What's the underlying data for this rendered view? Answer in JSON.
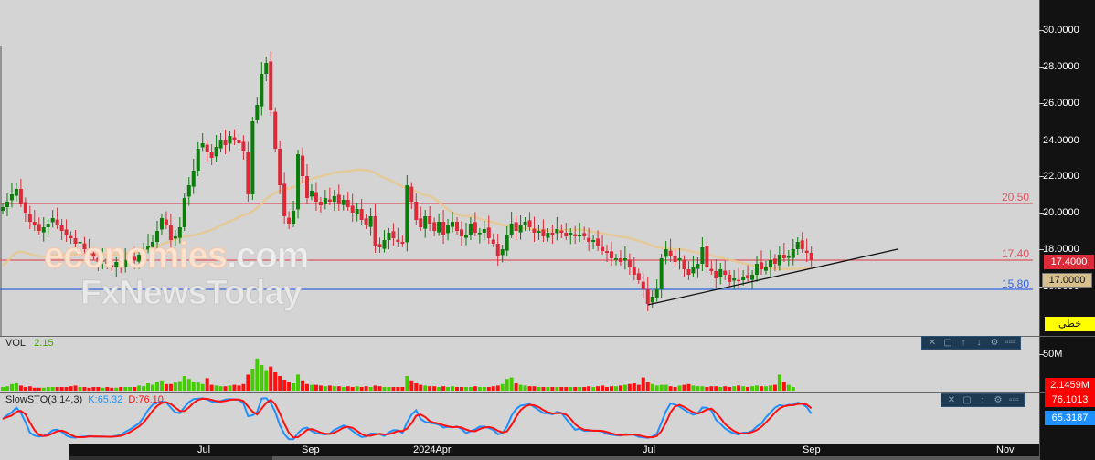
{
  "colors": {
    "up": "#0a7d0a",
    "down": "#dc2a38",
    "vol_up": "#44cc00",
    "vol_down": "#ff1010",
    "ma": "#e8c88e",
    "level_red": "#e05560",
    "level_blue": "#3366dd",
    "stoch_k": "#1e90ff",
    "stoch_d": "#ff1010",
    "trendline": "#111111"
  },
  "watermark": {
    "line1a": "economies",
    "line1b": ".com",
    "line2": "FxNewsToday"
  },
  "price_axis": {
    "ticks": [
      "30.0000",
      "28.0000",
      "26.0000",
      "24.0000",
      "22.0000",
      "20.0000",
      "18.0000",
      "16.0000"
    ],
    "current_price": "17.4000",
    "ma_value": "17.0000",
    "chart_type_label": "خطي"
  },
  "levels": [
    {
      "label": "20.50",
      "value": 20.5,
      "color": "red"
    },
    {
      "label": "17.40",
      "value": 17.4,
      "color": "red"
    },
    {
      "label": "15.80",
      "value": 15.8,
      "color": "blue"
    }
  ],
  "trendline": {
    "from": {
      "index": 142,
      "price": 14.95
    },
    "to": {
      "index": 197,
      "price": 18.0
    }
  },
  "volume_panel": {
    "title": "VOL",
    "value": "2.15",
    "axis_label": "50M",
    "current_label": "2.1459M"
  },
  "stoch_panel": {
    "title": "SlowSTO(3,14,3)",
    "k_label": "K:65.32",
    "d_label": "D:76.10",
    "d_axis": "76.1013",
    "k_axis": "65.3187"
  },
  "time_axis": [
    {
      "label": "Jul",
      "index": 44
    },
    {
      "label": "Sep",
      "index": 67
    },
    {
      "label": "2024Apr",
      "index": 94
    },
    {
      "label": "Jul",
      "index": 142
    },
    {
      "label": "Sep",
      "index": 177
    },
    {
      "label": "Nov",
      "index": 220
    }
  ],
  "panel_toolbar": {
    "icons": [
      "close-icon",
      "maximize-icon",
      "move-up-icon",
      "move-down-icon",
      "settings-icon",
      "more-icon"
    ]
  },
  "chart_data": {
    "type": "candlestick",
    "price_range": [
      14,
      31
    ],
    "close": [
      20.3,
      20.6,
      21.0,
      21.3,
      20.5,
      20.0,
      19.5,
      19.3,
      19.0,
      19.2,
      19.4,
      19.7,
      19.3,
      19.0,
      18.8,
      18.6,
      18.3,
      18.4,
      18.0,
      17.7,
      17.6,
      17.3,
      17.4,
      17.2,
      17.0,
      17.3,
      17.1,
      17.4,
      17.5,
      17.4,
      17.7,
      17.9,
      18.2,
      18.4,
      19.0,
      19.7,
      19.3,
      18.5,
      18.7,
      19.2,
      20.8,
      21.5,
      22.3,
      23.5,
      23.8,
      23.3,
      23.0,
      23.6,
      24.0,
      23.7,
      24.2,
      24.0,
      23.8,
      23.4,
      21.0,
      25.0,
      25.9,
      27.6,
      28.2,
      25.6,
      23.5,
      21.5,
      19.8,
      19.4,
      20.1,
      23.2,
      22.0,
      20.8,
      21.2,
      20.6,
      20.4,
      20.8,
      20.6,
      20.9,
      20.5,
      20.7,
      20.3,
      20.0,
      20.2,
      19.6,
      19.3,
      19.8,
      18.2,
      18.1,
      18.5,
      18.9,
      18.6,
      18.4,
      18.3,
      21.5,
      20.6,
      19.6,
      19.2,
      19.8,
      19.4,
      19.0,
      19.5,
      18.8,
      19.3,
      19.5,
      19.0,
      18.7,
      18.8,
      19.4,
      18.9,
      18.9,
      19.1,
      18.6,
      18.3,
      17.6,
      18.0,
      18.8,
      19.4,
      19.0,
      19.3,
      19.5,
      19.2,
      18.9,
      19.0,
      18.7,
      18.9,
      18.8,
      19.1,
      18.9,
      18.7,
      18.9,
      18.7,
      18.8,
      18.7,
      18.4,
      18.5,
      18.2,
      17.9,
      17.8,
      17.5,
      17.5,
      17.3,
      17.5,
      17.0,
      16.6,
      16.3,
      15.8,
      15.0,
      15.4,
      15.8,
      17.5,
      18.0,
      17.6,
      17.3,
      17.5,
      16.9,
      16.6,
      17.0,
      17.2,
      18.1,
      17.0,
      16.8,
      16.4,
      16.9,
      16.6,
      16.2,
      16.4,
      16.3,
      16.5,
      16.4,
      16.6,
      17.2,
      16.9,
      17.0,
      17.4,
      17.2,
      17.7,
      17.5,
      17.6,
      18.0,
      18.4,
      18.0,
      17.8,
      17.4
    ],
    "volume_millions": [
      5,
      6,
      9,
      10,
      7,
      5,
      6,
      4,
      4,
      4,
      5,
      5,
      5,
      5,
      5,
      6,
      7,
      5,
      5,
      4,
      5,
      5,
      4,
      5,
      4,
      4,
      5,
      5,
      5,
      5,
      7,
      6,
      10,
      8,
      12,
      14,
      9,
      9,
      11,
      13,
      20,
      16,
      12,
      11,
      9,
      17,
      8,
      7,
      6,
      6,
      7,
      8,
      7,
      9,
      22,
      30,
      44,
      35,
      28,
      33,
      25,
      20,
      15,
      12,
      10,
      22,
      14,
      9,
      8,
      8,
      7,
      6,
      7,
      6,
      6,
      5,
      6,
      5,
      6,
      5,
      6,
      5,
      7,
      6,
      5,
      5,
      5,
      5,
      5,
      20,
      14,
      10,
      8,
      7,
      6,
      6,
      5,
      6,
      5,
      6,
      5,
      5,
      5,
      5,
      6,
      5,
      5,
      5,
      6,
      7,
      9,
      16,
      18,
      10,
      8,
      7,
      6,
      6,
      5,
      5,
      5,
      5,
      5,
      5,
      5,
      5,
      5,
      5,
      5,
      6,
      5,
      6,
      7,
      5,
      6,
      6,
      7,
      8,
      9,
      10,
      8,
      18,
      12,
      9,
      7,
      8,
      8,
      6,
      5,
      7,
      8,
      9,
      7,
      6,
      6,
      5,
      6,
      6,
      5,
      6,
      5,
      6,
      7,
      6,
      5,
      6,
      7,
      6,
      6,
      7,
      8,
      22,
      12,
      8,
      5
    ],
    "ma_period": 40,
    "stoch": {
      "k_period": 14,
      "slowing": 3,
      "d_period": 3,
      "range": [
        0,
        100
      ]
    }
  }
}
